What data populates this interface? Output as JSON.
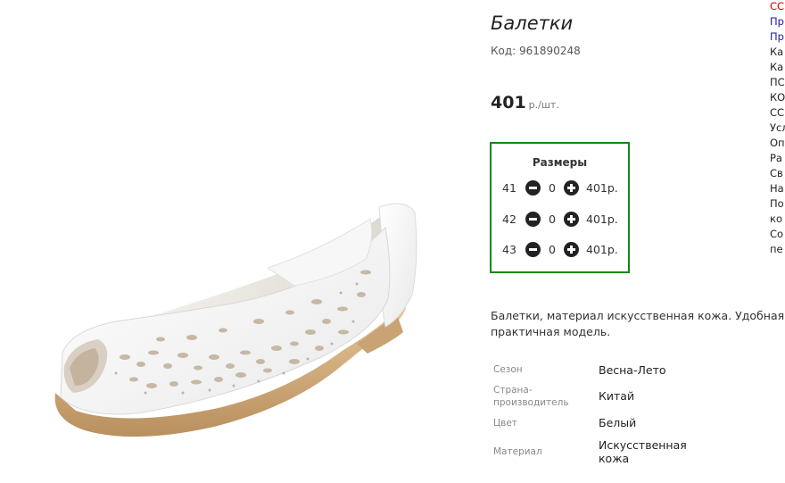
{
  "product": {
    "title": "Балетки",
    "code": "Код: 961890248",
    "price_value": "401",
    "price_unit": "р./шт."
  },
  "sizes": {
    "title": "Размеры",
    "rows": [
      {
        "size": "41",
        "qty": "0",
        "price": "401р."
      },
      {
        "size": "42",
        "qty": "0",
        "price": "401р."
      },
      {
        "size": "43",
        "qty": "0",
        "price": "401р."
      }
    ]
  },
  "description": "Балетки, материал искусственная кожа. Удобная практичная модель.",
  "attributes": [
    {
      "label": "Сезон",
      "value": "Весна-Лето"
    },
    {
      "label": "Страна-производитель",
      "value": "Китай"
    },
    {
      "label": "Цвет",
      "value": "Белый"
    },
    {
      "label": "Материал",
      "value": "Искусственная кожа"
    }
  ],
  "sidebar_cut": [
    "СС",
    "Пр",
    "Пр",
    "Ка",
    "Ка",
    "ПС",
    "КО",
    "СС",
    "Усл",
    "Оп",
    "Ра",
    "Св",
    "На",
    "По",
    "ко",
    "Со",
    "пе"
  ],
  "sidebar_colors": {
    "red": "#cc0000",
    "blue": "#1a1aa6",
    "dark": "#222222"
  },
  "accent": {
    "sizes_border": "#0d8a1a"
  }
}
